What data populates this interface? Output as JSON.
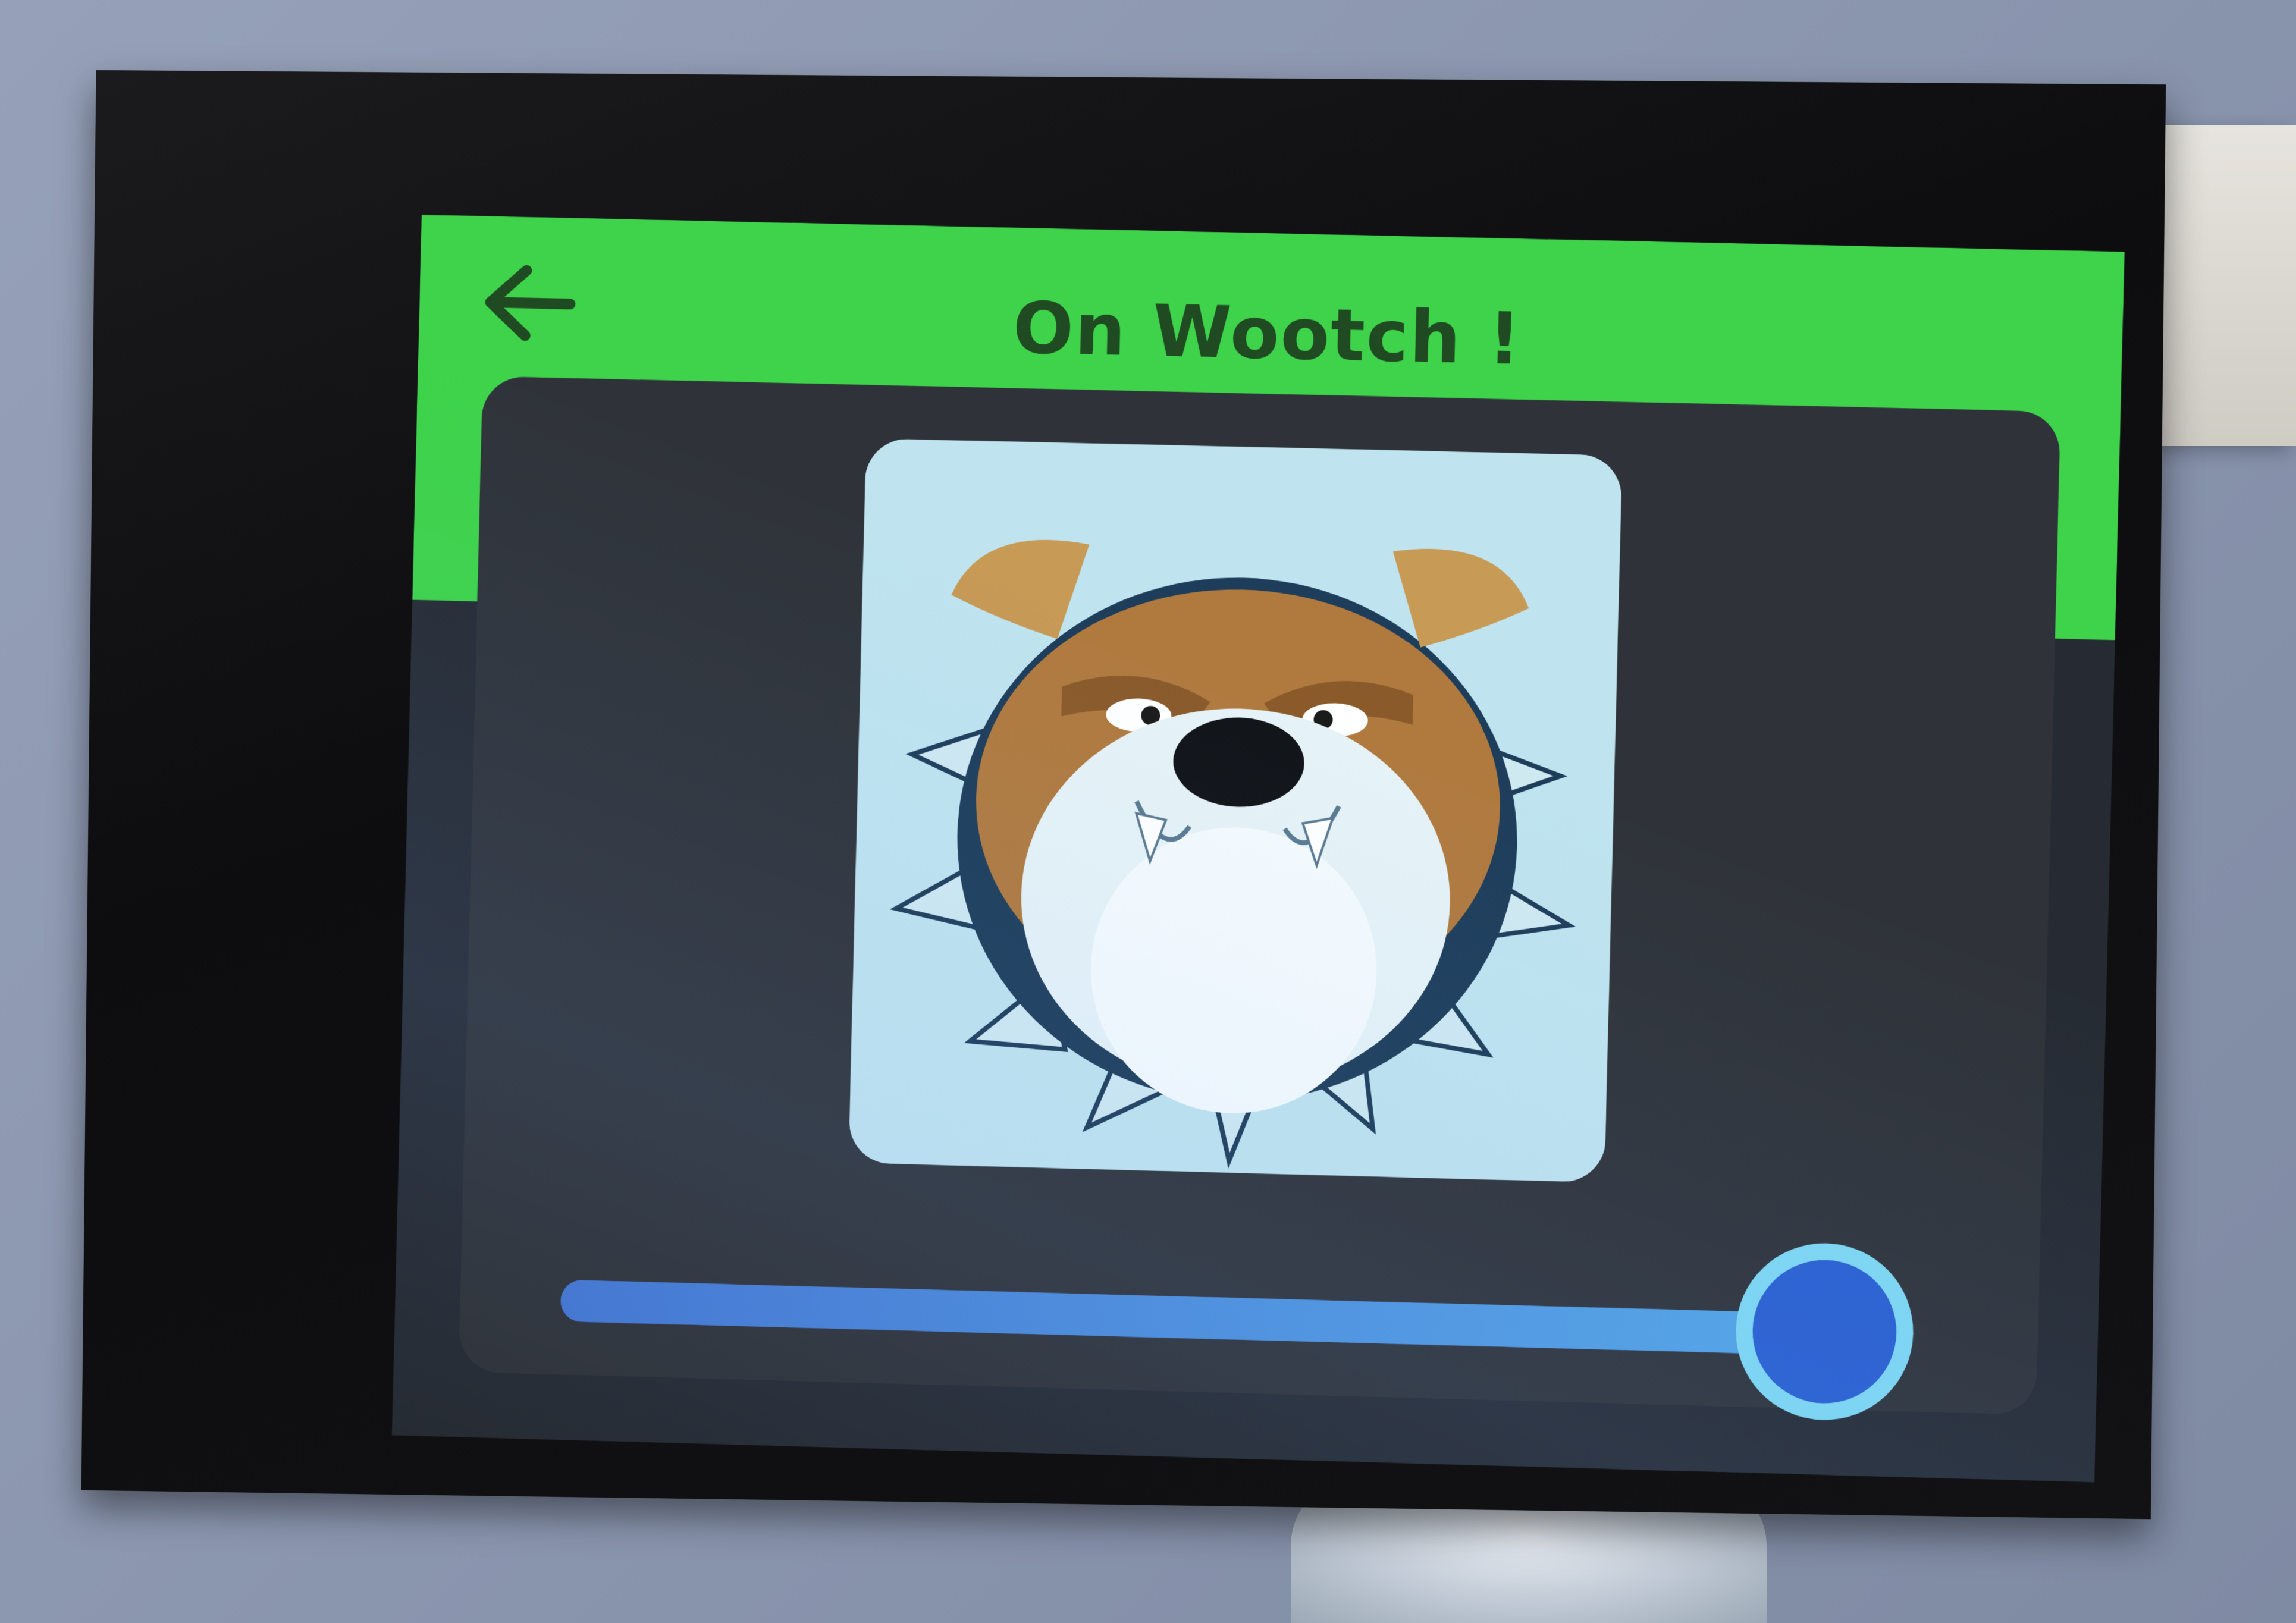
{
  "screen": {
    "title": "On Wootch !",
    "back_icon": "arrow-left-icon",
    "image_icon": "bulldog-icon",
    "slider_value": 0.94
  },
  "colors": {
    "header": "#3ed34a",
    "title_text": "#1f4a22",
    "panel": "#2f3339",
    "slider_track": "#4d8ad8",
    "slider_knob": "#2a5fd0",
    "slider_ring": "#7fd8f2",
    "image_background": "#bfe4ef"
  }
}
